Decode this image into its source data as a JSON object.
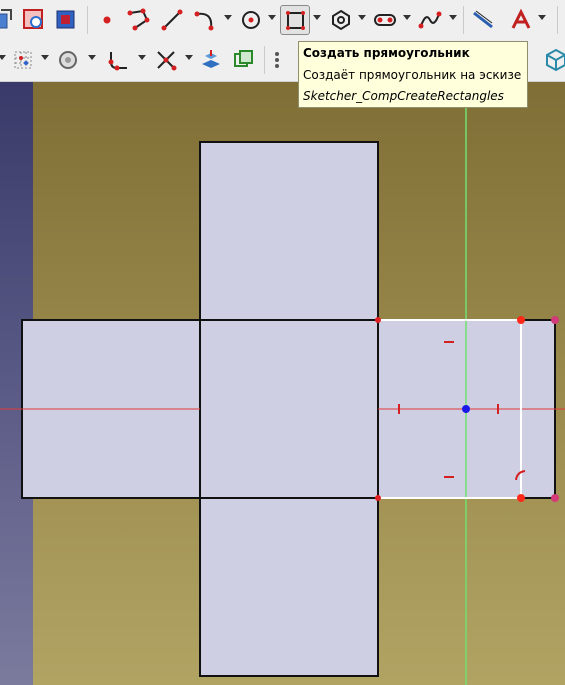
{
  "tooltip": {
    "title": "Создать прямоугольник",
    "description": "Создаёт прямоугольник на эскизе",
    "command": "Sketcher_CompCreateRectangles"
  },
  "toolbar_top": [
    {
      "name": "toolbar-leave-sketch-icon"
    },
    {
      "name": "toolbar-view-sketch-icon"
    },
    {
      "name": "toolbar-view-section-icon"
    },
    {
      "name": "toolbar-point-icon"
    },
    {
      "name": "toolbar-polyline-icon"
    },
    {
      "name": "toolbar-line-icon"
    },
    {
      "name": "toolbar-arc-icon"
    },
    {
      "name": "toolbar-circle-icon"
    },
    {
      "name": "toolbar-rectangle-icon"
    },
    {
      "name": "toolbar-polygon-icon"
    },
    {
      "name": "toolbar-slot-icon"
    },
    {
      "name": "toolbar-bspline-icon"
    },
    {
      "name": "toolbar-external-geometry-icon"
    },
    {
      "name": "toolbar-construction-mode-icon"
    }
  ],
  "toolbar_bottom": [
    {
      "name": "toolbar-grid-icon"
    },
    {
      "name": "toolbar-snap-icon"
    },
    {
      "name": "toolbar-fillet-icon"
    },
    {
      "name": "toolbar-trim-icon"
    },
    {
      "name": "toolbar-extend-icon"
    },
    {
      "name": "toolbar-carbon-copy-icon"
    },
    {
      "name": "toolbar-clone-icon"
    },
    {
      "name": "toolbar-array-icon"
    },
    {
      "name": "toolbar-view-3d-icon"
    }
  ],
  "colors": {
    "face_fill": "#cfcfe4",
    "edge": "#111111",
    "x_axis": "#e03a3a",
    "y_axis": "#70e070",
    "selected_edge": "#ffffff",
    "vertex": "#ff2a1a",
    "origin": "#1a1ae8",
    "tooltip_bg": "#ffffdc"
  }
}
